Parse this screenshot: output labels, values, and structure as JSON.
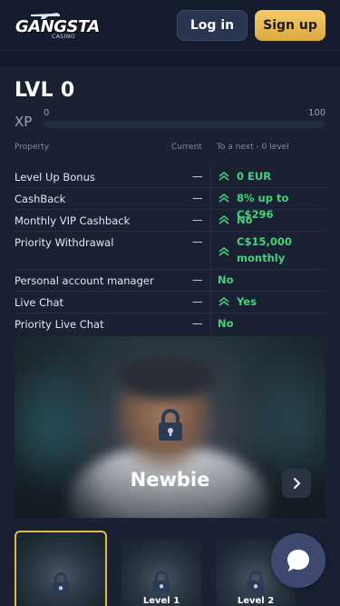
{
  "header": {
    "logo_text": "GANGSTA",
    "logo_sub": "CASINO",
    "login_label": "Log in",
    "signup_label": "Sign up"
  },
  "level": {
    "title": "LVL 0",
    "xp_label": "XP",
    "xp_min": "0",
    "xp_max": "100",
    "xp_progress": 0
  },
  "table": {
    "col_property": "Property",
    "col_current": "Current",
    "col_next": "To a next - 0 level",
    "rows": [
      {
        "name": "Level Up Bonus",
        "current": "—",
        "next": "0 EUR",
        "icon": "double-chevron-up-icon"
      },
      {
        "name": "CashBack",
        "current": "—",
        "next": "8% up to C$296",
        "icon": "double-chevron-up-icon"
      },
      {
        "name": "Monthly VIP Cashback",
        "current": "—",
        "next": "No",
        "icon": "double-chevron-up-icon"
      },
      {
        "name": "Priority Withdrawal",
        "current": "—",
        "next_line1": "C$15,000",
        "next_line2": "monthly",
        "icon": "double-chevron-up-icon"
      },
      {
        "name": "Personal account manager",
        "current": "—",
        "next": "No"
      },
      {
        "name": "Live Chat",
        "current": "—",
        "next": "Yes",
        "icon": "double-chevron-up-icon"
      },
      {
        "name": "Priority Live Chat",
        "current": "—",
        "next": "No"
      }
    ]
  },
  "hero": {
    "title": "Newbie"
  },
  "thumbs": [
    {
      "label": ""
    },
    {
      "label": "Level 1"
    },
    {
      "label": "Level 2"
    }
  ],
  "colors": {
    "accent_gold": "#e0b94c",
    "positive_green": "#46d27a",
    "background": "#141a2b"
  }
}
